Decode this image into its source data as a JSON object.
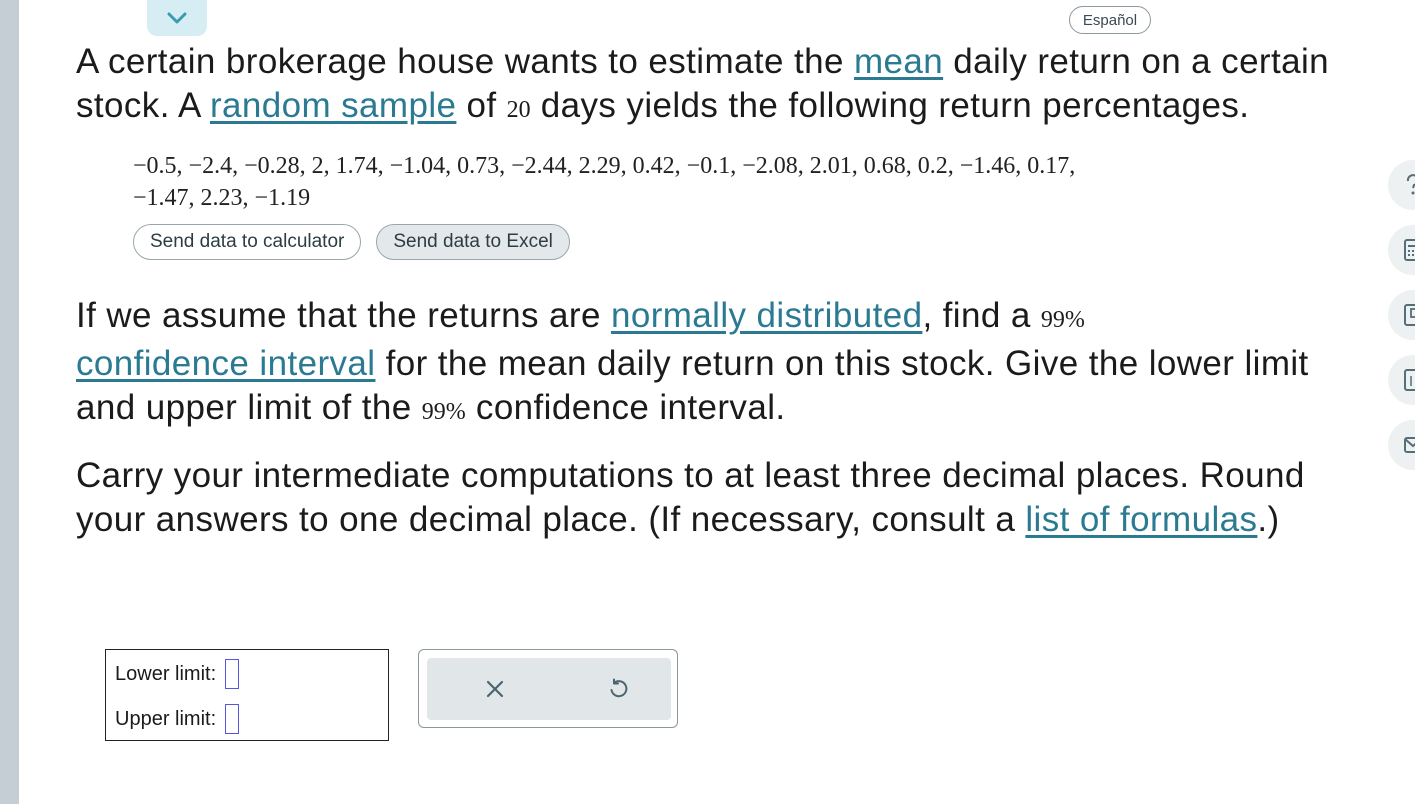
{
  "header": {
    "collapse_icon": "chevron-down-icon",
    "language_button": "Español"
  },
  "question": {
    "p1": {
      "t1": "A certain brokerage house wants to estimate the ",
      "link_mean": "mean",
      "t2": " daily return on a certain stock. A ",
      "link_random_sample": "random sample",
      "t3": " of ",
      "sample_size": "20",
      "t4": " days yields the following return percentages."
    },
    "data": {
      "line1": "−0.5, −2.4, −0.28, 2, 1.74, −1.04, 0.73, −2.44, 2.29, 0.42, −0.1, −2.08, 2.01, 0.68, 0.2, −1.46, 0.17,",
      "line2": "−1.47, 2.23, −1.19",
      "values": [
        -0.5,
        -2.4,
        -0.28,
        2,
        1.74,
        -1.04,
        0.73,
        -2.44,
        2.29,
        0.42,
        -0.1,
        -2.08,
        2.01,
        0.68,
        0.2,
        -1.46,
        0.17,
        -1.47,
        2.23,
        -1.19
      ],
      "send_calculator_label": "Send data to calculator",
      "send_excel_label": "Send data to Excel"
    },
    "p2": {
      "t1": "If we assume that the returns are ",
      "link_normally_distributed": "normally distributed",
      "t2": ", find a ",
      "conf_level_1": "99%",
      "link_confidence_interval": "confidence interval",
      "t3": " for the mean daily return on this stock. Give the lower limit and upper limit of the ",
      "conf_level_2": "99%",
      "t4": " confidence interval."
    },
    "p3": {
      "t1": "Carry your intermediate computations to at least three decimal places. Round your answers to one decimal place. (If necessary, consult a ",
      "link_formulas": "list of formulas",
      "t2": ".)"
    }
  },
  "answer": {
    "lower_label": "Lower limit:",
    "upper_label": "Upper limit:",
    "lower_value": "",
    "upper_value": ""
  },
  "actions": {
    "clear_icon": "close-icon",
    "undo_icon": "undo-icon"
  },
  "side_tools": [
    "help-icon",
    "calculator-icon",
    "book-icon",
    "notes-icon",
    "mail-icon"
  ]
}
